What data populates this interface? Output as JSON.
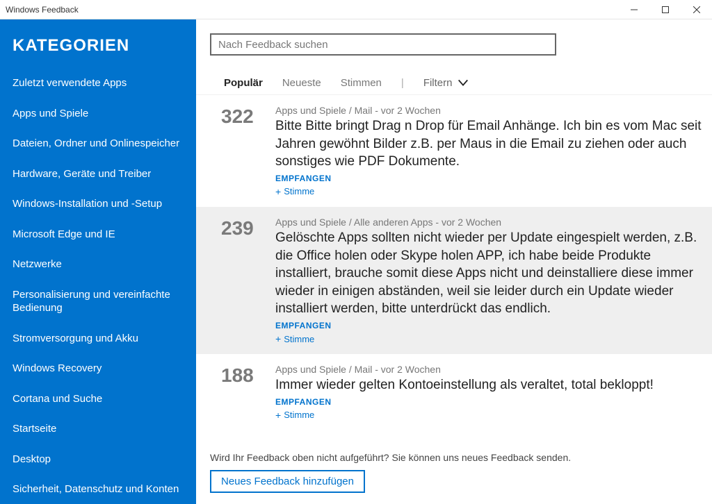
{
  "window": {
    "title": "Windows Feedback"
  },
  "sidebar": {
    "heading": "KATEGORIEN",
    "items": [
      "Zuletzt verwendete Apps",
      "Apps und Spiele",
      "Dateien, Ordner und Onlinespeicher",
      "Hardware, Geräte und Treiber",
      "Windows-Installation und -Setup",
      "Microsoft Edge und IE",
      "Netzwerke",
      "Personalisierung und vereinfachte Bedienung",
      "Stromversorgung und Akku",
      "Windows Recovery",
      "Cortana und Suche",
      "Startseite",
      "Desktop",
      "Sicherheit, Datenschutz und Konten"
    ]
  },
  "search": {
    "placeholder": "Nach Feedback suchen"
  },
  "tabs": {
    "popular": "Populär",
    "newest": "Neueste",
    "votes": "Stimmen",
    "filter": "Filtern"
  },
  "feedback": [
    {
      "votes": "322",
      "meta": "Apps und Spiele / Mail - vor 2 Wochen",
      "text": "Bitte Bitte bringt Drag n Drop für Email Anhänge. Ich bin es vom Mac seit Jahren gewöhnt Bilder z.B. per Maus in die Email zu ziehen oder auch sonstiges wie PDF Dokumente.",
      "status": "EMPFANGEN",
      "vote_label": "Stimme"
    },
    {
      "votes": "239",
      "meta": "Apps und Spiele / Alle anderen Apps - vor 2 Wochen",
      "text": "Gelöschte Apps sollten nicht wieder per Update eingespielt werden, z.B. die Office holen oder Skype holen APP, ich habe beide Produkte installiert, brauche somit diese Apps nicht und deinstalliere diese immer wieder in einigen abständen, weil sie leider durch ein Update wieder installiert werden, bitte unterdrückt das endlich.",
      "status": "EMPFANGEN",
      "vote_label": "Stimme"
    },
    {
      "votes": "188",
      "meta": "Apps und Spiele / Mail - vor 2 Wochen",
      "text": "Immer wieder gelten Kontoeinstellung als veraltet, total bekloppt!",
      "status": "EMPFANGEN",
      "vote_label": "Stimme"
    }
  ],
  "footer": {
    "prompt": "Wird Ihr Feedback oben nicht aufgeführt? Sie können uns neues Feedback senden.",
    "button": "Neues Feedback hinzufügen"
  }
}
